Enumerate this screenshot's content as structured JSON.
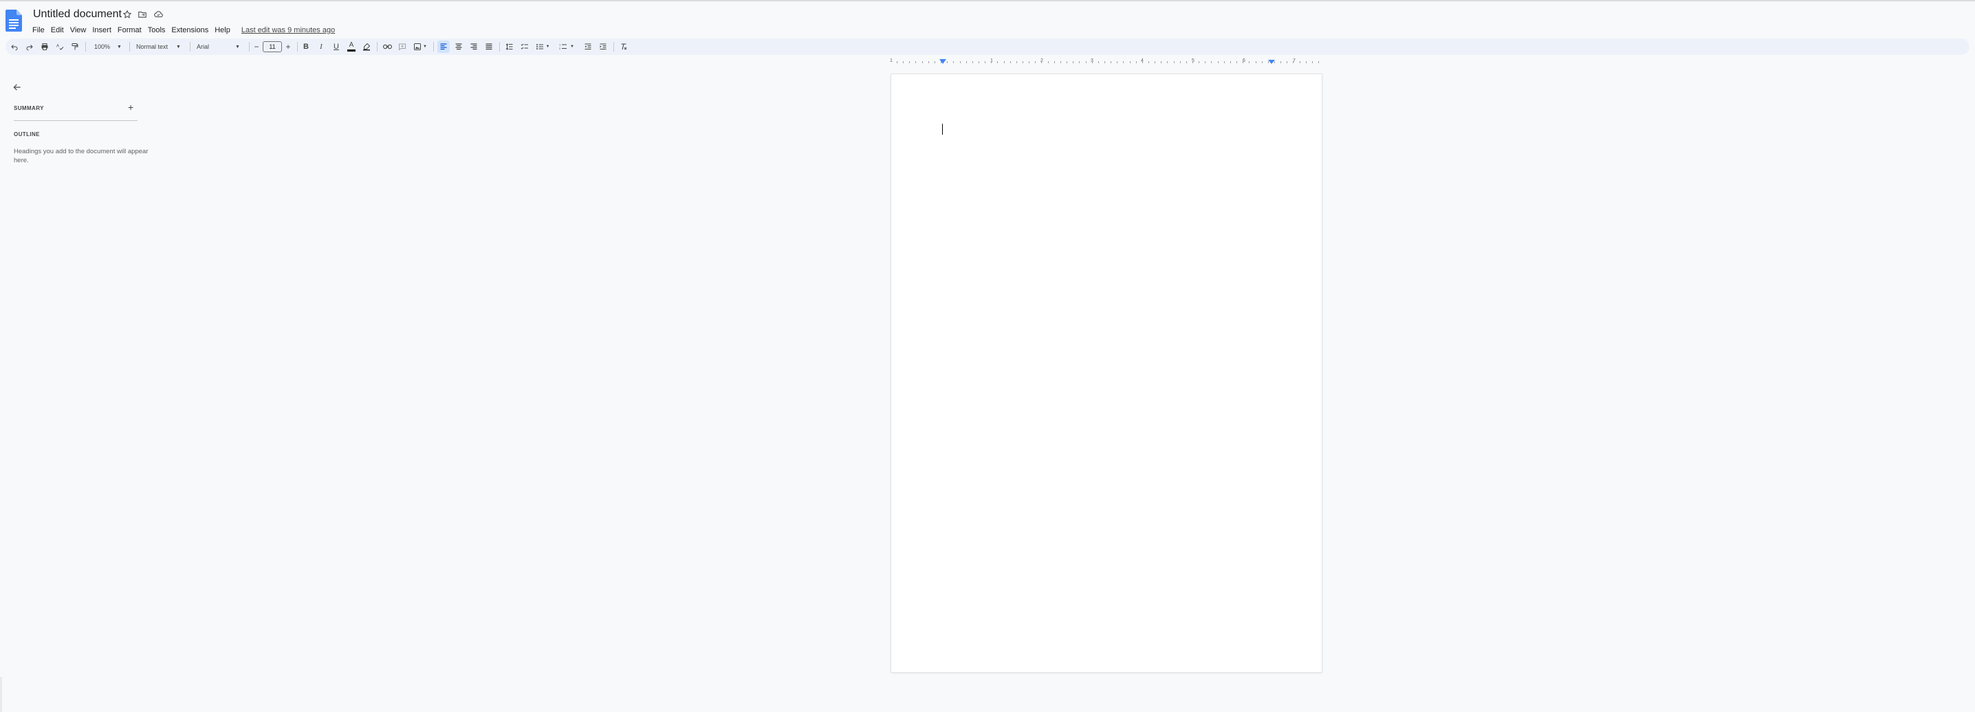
{
  "app": {
    "doc_title": "Untitled document",
    "last_edit": "Last edit was 9 minutes ago"
  },
  "menu": [
    "File",
    "Edit",
    "View",
    "Insert",
    "Format",
    "Tools",
    "Extensions",
    "Help"
  ],
  "toolbar": {
    "zoom": "100%",
    "style": "Normal text",
    "font": "Arial",
    "font_size": "11",
    "colors": {
      "toolbar_bg": "#edf2fa",
      "active_bg": "#d3e3fd",
      "accent": "#4285f4",
      "text_color_bar": "#000000",
      "highlight": "#1f1f1f"
    }
  },
  "ruler": {
    "labels": [
      "1",
      "1",
      "2",
      "3",
      "4",
      "5",
      "6",
      "7"
    ]
  },
  "side_panel": {
    "summary_label": "SUMMARY",
    "outline_label": "OUTLINE",
    "outline_help": "Headings you add to the document will appear here."
  }
}
